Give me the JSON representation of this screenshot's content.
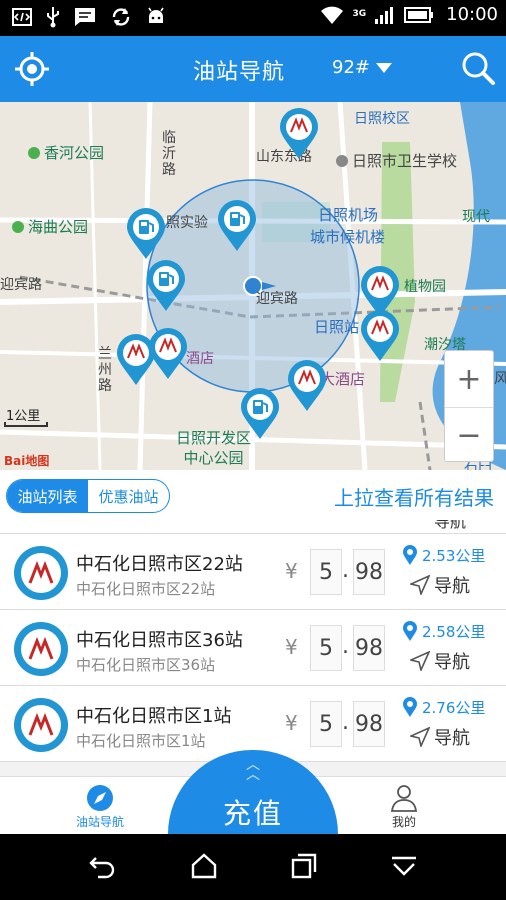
{
  "status_bar": {
    "time": "10:00",
    "network": "3G",
    "icons": [
      "developer-icon",
      "usb-icon",
      "message-icon",
      "sync-icon",
      "android-icon",
      "wifi-icon",
      "signal-icon",
      "battery-icon"
    ]
  },
  "header": {
    "title": "油站导航",
    "fuel_type": "92#",
    "icons": [
      "locate-icon",
      "search-icon"
    ]
  },
  "map": {
    "labels": {
      "xianghe_park": "香河公园",
      "haiqu_park": "海曲公园",
      "linyi_road": "临沂路",
      "shandong_road": "山东东路",
      "rizhao_school": "日照校区",
      "health_school": "日照市卫生学校",
      "airport": "日照机场",
      "airport_building": "城市候机楼",
      "xiandai": "现代",
      "yingbin_road_left": "迎宾路",
      "yingbin_road_center": "迎宾路",
      "rizhao_station": "日照站",
      "botanical_garden": "植物园",
      "chaoxi_tower": "潮汐塔",
      "lanzhou_road": "兰州路",
      "hotel_left": "酒店",
      "hotel_right": "大酒店",
      "dev_zone_park_1": "日照开发区",
      "dev_zone_park_2": "中心公园",
      "shiriri": "石臼",
      "feng": "风",
      "shiyan": "照实验",
      "scale": "1公里",
      "baidu_logo": "Bai地图"
    },
    "zoom_in": "+",
    "zoom_out": "−"
  },
  "tabs": {
    "list_tab": "油站列表",
    "discount_tab": "优惠油站",
    "pull_hint": "上拉查看所有结果"
  },
  "peek_item": {
    "nav_label": "导航"
  },
  "stations": [
    {
      "name": "中石化日照市区22站",
      "sub": "中石化日照市区22站",
      "currency": "¥",
      "price_int": "5",
      "price_dec": "98",
      "distance": "2.53公里",
      "nav_label": "导航"
    },
    {
      "name": "中石化日照市区36站",
      "sub": "中石化日照市区36站",
      "currency": "¥",
      "price_int": "5",
      "price_dec": "98",
      "distance": "2.58公里",
      "nav_label": "导航"
    },
    {
      "name": "中石化日照市区1站",
      "sub": "中石化日照市区1站",
      "currency": "¥",
      "price_int": "5",
      "price_dec": "98",
      "distance": "2.76公里",
      "nav_label": "导航"
    }
  ],
  "bottom_nav": {
    "left_label": "油站导航",
    "center_label": "充值",
    "right_label": "我的"
  },
  "colors": {
    "brand": "#1e8ce6",
    "map_bg": "#ece8df",
    "water": "#5fa8e0"
  }
}
